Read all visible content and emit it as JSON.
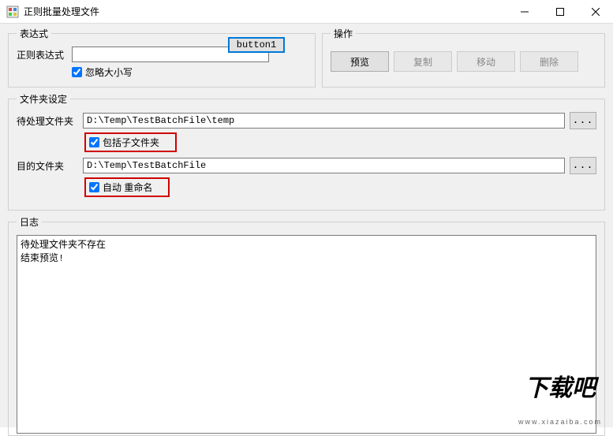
{
  "window": {
    "title": "正则批量处理文件"
  },
  "expr": {
    "legend": "表达式",
    "label": "正则表达式",
    "value": "",
    "ignoreCase_label": "忽略大小写",
    "button1": "button1"
  },
  "ops": {
    "legend": "操作",
    "preview": "预览",
    "copy": "复制",
    "move": "移动",
    "delete": "删除"
  },
  "folders": {
    "legend": "文件夹设定",
    "src_label": "待处理文件夹",
    "src_value": "D:\\Temp\\TestBatchFile\\temp",
    "includeSub_label": "包括子文件夹",
    "dst_label": "目的文件夹",
    "dst_value": "D:\\Temp\\TestBatchFile",
    "autoRename_label": "自动 重命名",
    "browse": "..."
  },
  "log": {
    "legend": "日志",
    "content": "待处理文件夹不存在\n结束预览!"
  },
  "watermark": {
    "big": "下载吧",
    "url": "www.xiazaiba.com"
  }
}
